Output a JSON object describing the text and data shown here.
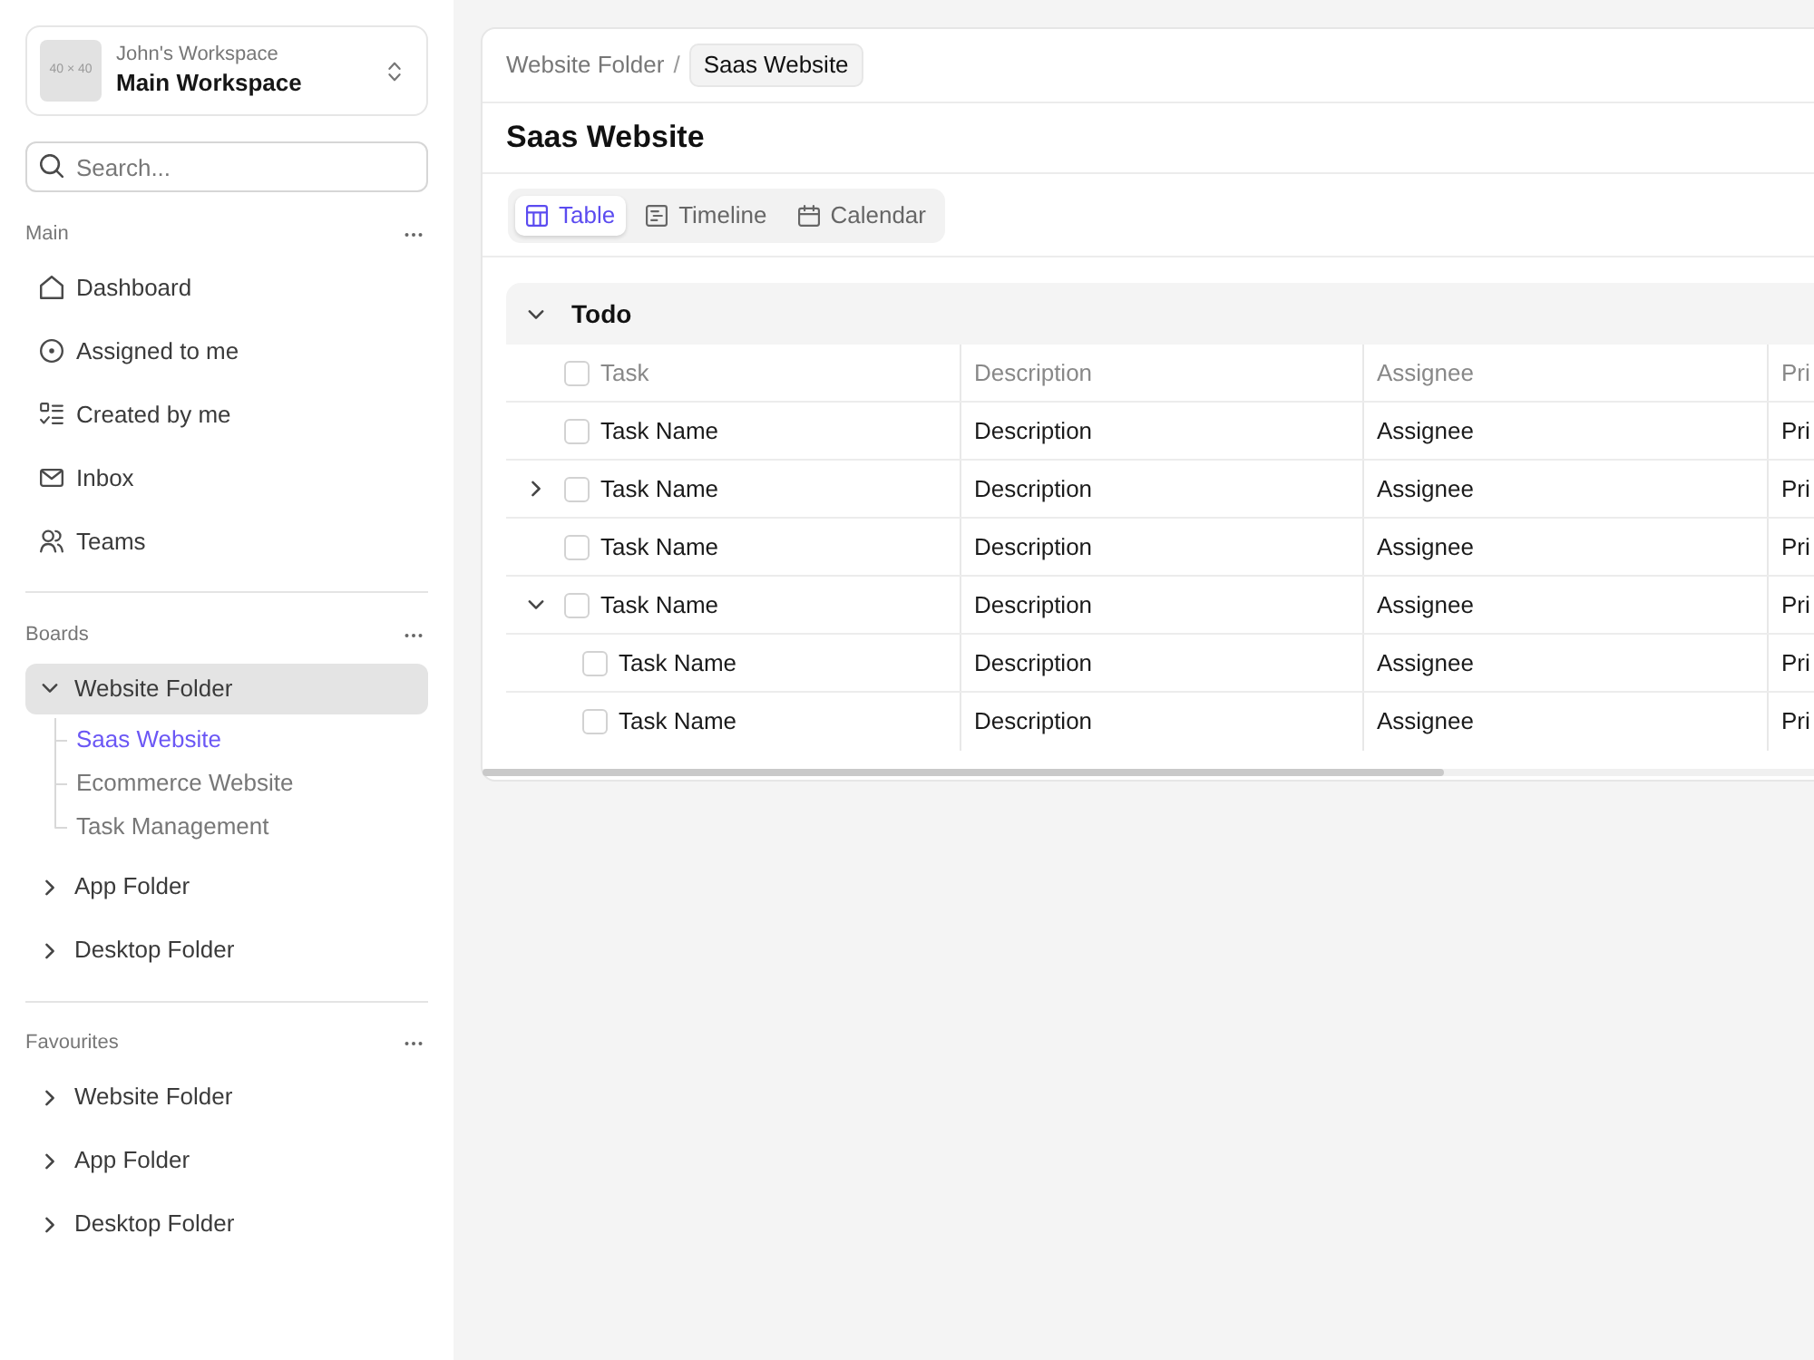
{
  "sidebar": {
    "workspace": {
      "avatar_label": "40 × 40",
      "owner": "John's Workspace",
      "name": "Main Workspace"
    },
    "search": {
      "placeholder": "Search..."
    },
    "sections": [
      {
        "kind": "nav",
        "title": "Main",
        "items": [
          {
            "label": "Dashboard",
            "selected": false
          },
          {
            "label": "Assigned to me",
            "selected": false
          },
          {
            "label": "Created by me",
            "selected": false
          },
          {
            "label": "Inbox",
            "selected": false
          },
          {
            "label": "Teams",
            "selected": false
          }
        ]
      },
      {
        "kind": "folders",
        "title": "Boards",
        "items": [
          {
            "label": "Website Folder",
            "selected": true,
            "expanded": true,
            "children": [
              {
                "label": "Saas Website",
                "selected": true
              },
              {
                "label": "Ecommerce Website",
                "selected": false
              },
              {
                "label": "Task Management",
                "selected": false
              }
            ]
          },
          {
            "label": "App Folder",
            "selected": false,
            "expanded": false
          },
          {
            "label": "Desktop Folder",
            "selected": false,
            "expanded": false
          }
        ]
      },
      {
        "kind": "folders",
        "title": "Favourites",
        "items": [
          {
            "label": "Website Folder",
            "selected": false,
            "expanded": false
          },
          {
            "label": "App Folder",
            "selected": false,
            "expanded": false
          },
          {
            "label": "Desktop Folder",
            "selected": false,
            "expanded": false
          }
        ]
      }
    ]
  },
  "main": {
    "breadcrumb": {
      "parent": "Website Folder",
      "separator": "/",
      "current": "Saas Website"
    },
    "title": "Saas Website",
    "views": [
      {
        "label": "Table",
        "selected": true
      },
      {
        "label": "Timeline",
        "selected": false
      },
      {
        "label": "Calendar",
        "selected": false
      }
    ],
    "groups": [
      {
        "title": "Todo",
        "expanded": true,
        "select_all_checked": false,
        "columns": [
          "Task",
          "Description",
          "Assignee",
          "Pri"
        ],
        "rows": [
          {
            "kind": "task",
            "checked": false,
            "cells": [
              "Task Name",
              "Description",
              "Assignee",
              "Pri"
            ]
          },
          {
            "kind": "parent",
            "expanded": false,
            "checked": false,
            "cells": [
              "Task Name",
              "Description",
              "Assignee",
              "Pri"
            ]
          },
          {
            "kind": "task",
            "checked": false,
            "cells": [
              "Task Name",
              "Description",
              "Assignee",
              "Pri"
            ]
          },
          {
            "kind": "parent",
            "expanded": true,
            "checked": false,
            "cells": [
              "Task Name",
              "Description",
              "Assignee",
              "Pri"
            ],
            "children": [
              {
                "kind": "task",
                "checked": false,
                "cells": [
                  "Task Name",
                  "Description",
                  "Assignee",
                  "Pri"
                ]
              },
              {
                "kind": "task",
                "checked": false,
                "cells": [
                  "Task Name",
                  "Description",
                  "Assignee",
                  "Pri"
                ]
              }
            ]
          }
        ]
      }
    ]
  }
}
